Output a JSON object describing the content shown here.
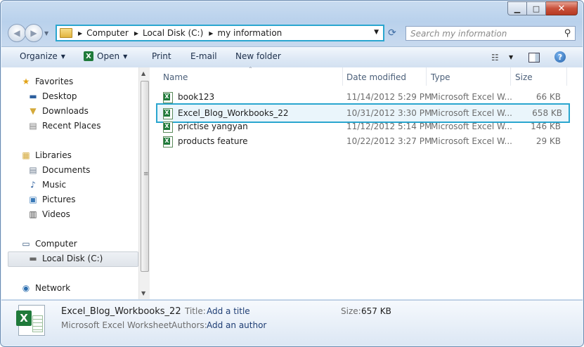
{
  "window": {
    "caption": {
      "minimize_icon": "minimize-icon",
      "maximize_icon": "maximize-icon",
      "close_icon": "close-icon"
    }
  },
  "address": {
    "crumbs": [
      "Computer",
      "Local Disk (C:)",
      "my information"
    ]
  },
  "search": {
    "placeholder": "Search my information"
  },
  "toolbar": {
    "organize": "Organize",
    "open": "Open",
    "print": "Print",
    "email": "E-mail",
    "new_folder": "New folder"
  },
  "sidebar": {
    "favorites": {
      "label": "Favorites",
      "items": [
        "Desktop",
        "Downloads",
        "Recent Places"
      ]
    },
    "libraries": {
      "label": "Libraries",
      "items": [
        "Documents",
        "Music",
        "Pictures",
        "Videos"
      ]
    },
    "computer": {
      "label": "Computer",
      "items": [
        "Local Disk (C:)"
      ]
    },
    "network": {
      "label": "Network"
    }
  },
  "columns": {
    "name": "Name",
    "date": "Date modified",
    "type": "Type",
    "size": "Size"
  },
  "files": [
    {
      "name": "book123",
      "date": "11/14/2012 5:29 PM",
      "type": "Microsoft Excel W...",
      "size": "66 KB"
    },
    {
      "name": "Excel_Blog_Workbooks_22",
      "date": "10/31/2012 3:30 PM",
      "type": "Microsoft Excel W...",
      "size": "658 KB",
      "selected": true
    },
    {
      "name": "prictise yangyan",
      "date": "11/12/2012 5:14 PM",
      "type": "Microsoft Excel W...",
      "size": "146 KB"
    },
    {
      "name": "products feature",
      "date": "10/22/2012 3:27 PM",
      "type": "Microsoft Excel W...",
      "size": "29 KB"
    }
  ],
  "details": {
    "filename": "Excel_Blog_Workbooks_22",
    "filetype": "Microsoft Excel Worksheet",
    "title_label": "Title:",
    "title_value": "Add a title",
    "authors_label": "Authors:",
    "authors_value": "Add an author",
    "size_label": "Size:",
    "size_value": "657 KB"
  },
  "colors": {
    "selection_border": "#2aa6cf",
    "chrome": "#c7d9ee",
    "excel_green": "#1f7a3a"
  }
}
